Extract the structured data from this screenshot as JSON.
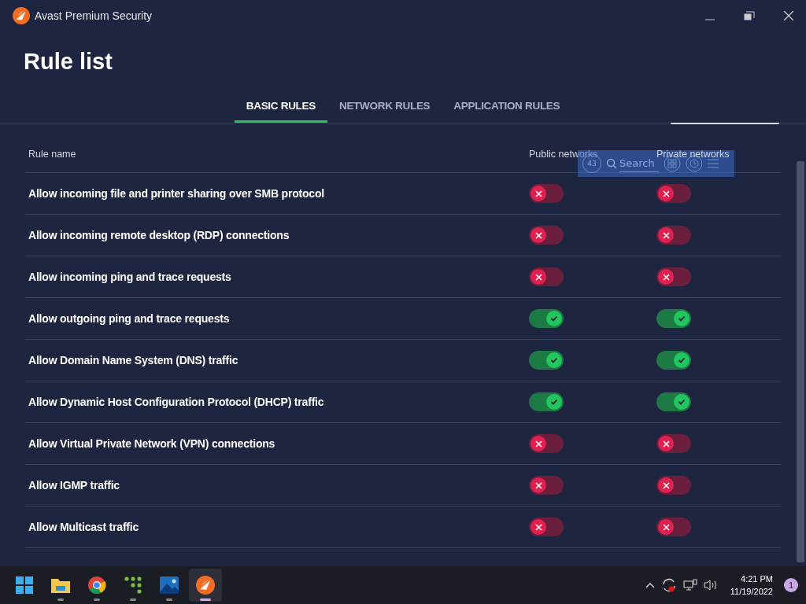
{
  "window": {
    "title": "Avast Premium Security"
  },
  "page_title": "Rule list",
  "tabs": [
    {
      "label": "BASIC RULES",
      "selected": true
    },
    {
      "label": "NETWORK RULES",
      "selected": false
    },
    {
      "label": "APPLICATION RULES",
      "selected": false
    }
  ],
  "table": {
    "columns": [
      "Rule name",
      "Public networks",
      "Private networks"
    ],
    "rows": [
      {
        "name": "Allow incoming file and printer sharing over SMB protocol",
        "public": false,
        "private": false
      },
      {
        "name": "Allow incoming remote desktop (RDP) connections",
        "public": false,
        "private": false
      },
      {
        "name": "Allow incoming ping and trace requests",
        "public": false,
        "private": false
      },
      {
        "name": "Allow outgoing ping and trace requests",
        "public": true,
        "private": true
      },
      {
        "name": "Allow Domain Name System (DNS) traffic",
        "public": true,
        "private": true
      },
      {
        "name": "Allow Dynamic Host Configuration Protocol (DHCP) traffic",
        "public": true,
        "private": true
      },
      {
        "name": "Allow Virtual Private Network (VPN) connections",
        "public": false,
        "private": false
      },
      {
        "name": "Allow IGMP traffic",
        "public": false,
        "private": false
      },
      {
        "name": "Allow Multicast traffic",
        "public": false,
        "private": false
      }
    ]
  },
  "overlay_toolbar": {
    "counter": "43",
    "search_placeholder": "Search"
  },
  "taskbar": {
    "apps": [
      {
        "kind": "start",
        "active": false
      },
      {
        "kind": "folder",
        "active": false
      },
      {
        "kind": "chrome",
        "active": false
      },
      {
        "kind": "dots",
        "active": false
      },
      {
        "kind": "photos",
        "active": false
      },
      {
        "kind": "avast",
        "active": true
      }
    ],
    "time": "4:21 PM",
    "date": "11/19/2022",
    "notifications": "1"
  }
}
